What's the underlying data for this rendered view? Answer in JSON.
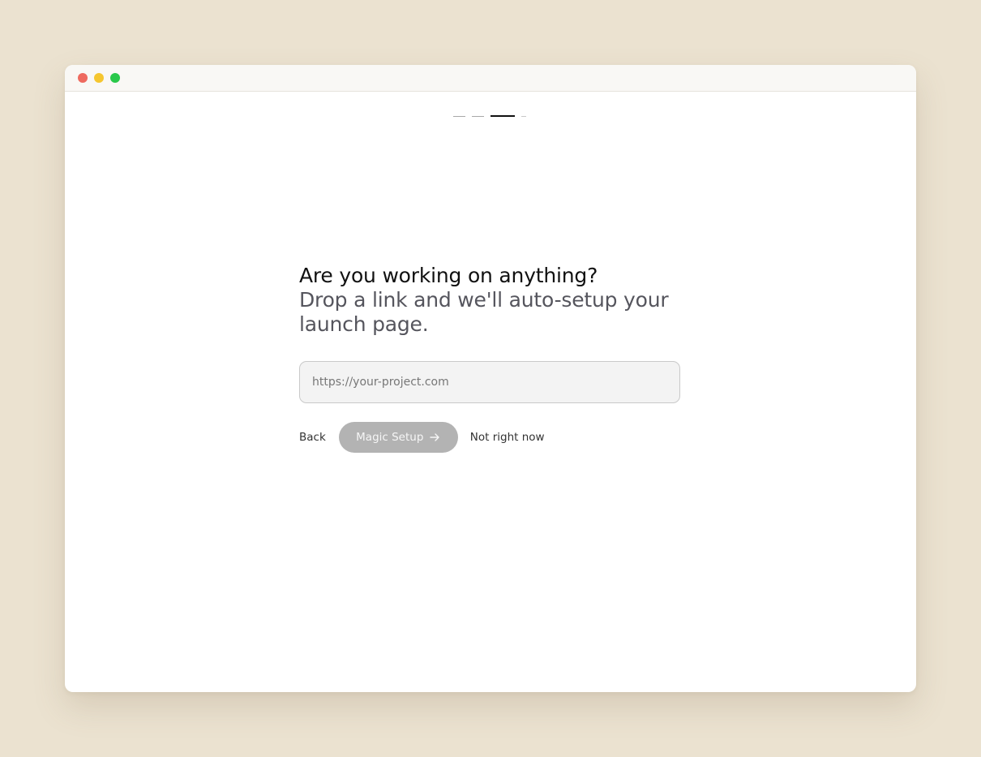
{
  "window": {
    "controls": [
      "close",
      "minimize",
      "zoom"
    ]
  },
  "progress": {
    "total_steps": 4,
    "current_step": 3
  },
  "main": {
    "heading": "Are you working on anything?",
    "subheading": "Drop a link and we'll auto-setup your launch page.",
    "url_input": {
      "value": "",
      "placeholder": "https://your-project.com"
    },
    "actions": {
      "back_label": "Back",
      "magic_setup_label": "Magic Setup",
      "magic_setup_icon": "arrow-right-icon",
      "skip_label": "Not right now"
    }
  },
  "colors": {
    "background": "#ebe2d0",
    "disabled_button": "#b3b3b3",
    "active_step": "#111111",
    "close_dot": "#ee6a5f",
    "minimize_dot": "#f5c62f",
    "zoom_dot": "#29c84a"
  }
}
